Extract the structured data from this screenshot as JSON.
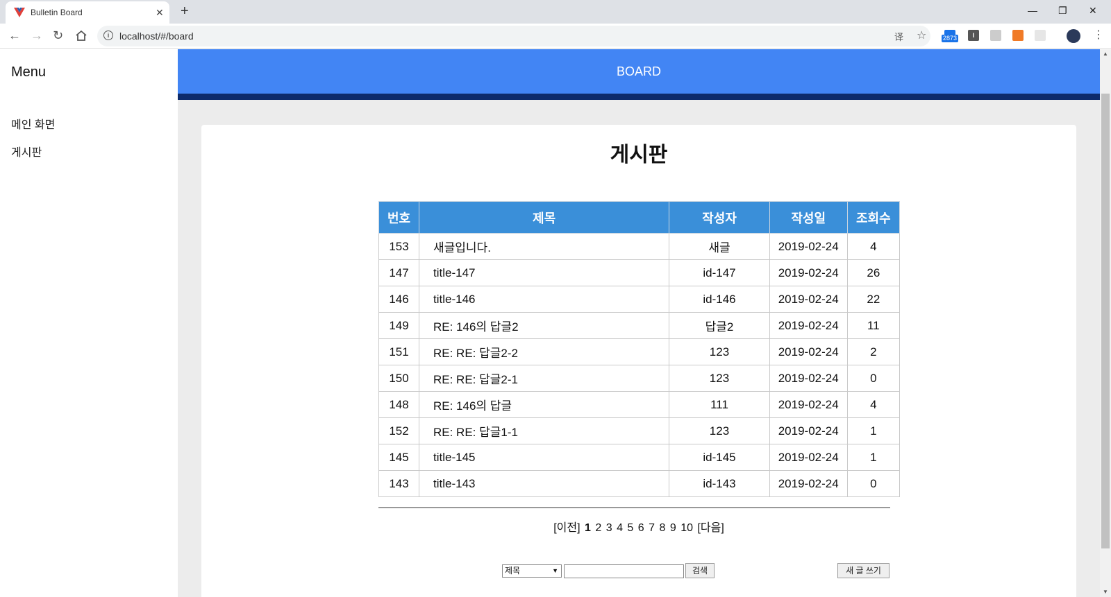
{
  "browser": {
    "tab_title": "Bulletin Board",
    "tab_close": "✕",
    "new_tab": "+",
    "url": "localhost/#/board",
    "ext_badge": "2873"
  },
  "sidebar": {
    "title": "Menu",
    "items": [
      {
        "label": "메인 화면"
      },
      {
        "label": "게시판"
      }
    ]
  },
  "header": {
    "title": "BOARD"
  },
  "board": {
    "title": "게시판",
    "columns": [
      "번호",
      "제목",
      "작성자",
      "작성일",
      "조회수"
    ],
    "rows": [
      [
        "153",
        "새글입니다.",
        "새글",
        "2019-02-24",
        "4"
      ],
      [
        "147",
        "title-147",
        "id-147",
        "2019-02-24",
        "26"
      ],
      [
        "146",
        "title-146",
        "id-146",
        "2019-02-24",
        "22"
      ],
      [
        "149",
        "RE: 146의 답글2",
        "답글2",
        "2019-02-24",
        "11"
      ],
      [
        "151",
        "RE: RE: 답글2-2",
        "123",
        "2019-02-24",
        "2"
      ],
      [
        "150",
        "RE: RE: 답글2-1",
        "123",
        "2019-02-24",
        "0"
      ],
      [
        "148",
        "RE: 146의 답글",
        "111",
        "2019-02-24",
        "4"
      ],
      [
        "152",
        "RE: RE: 답글1-1",
        "123",
        "2019-02-24",
        "1"
      ],
      [
        "145",
        "title-145",
        "id-145",
        "2019-02-24",
        "1"
      ],
      [
        "143",
        "title-143",
        "id-143",
        "2019-02-24",
        "0"
      ]
    ]
  },
  "pager": {
    "prev": "[이전]",
    "pages": [
      "1",
      "2",
      "3",
      "4",
      "5",
      "6",
      "7",
      "8",
      "9",
      "10"
    ],
    "current": "1",
    "next": "[다음]"
  },
  "search": {
    "field_selected": "제목",
    "query": "",
    "search_button": "검색",
    "write_button": "새 글 쓰기"
  },
  "colors": {
    "header": "#4285f4",
    "header_strip": "#0d2b6b",
    "table_header": "#3a8fd9"
  }
}
